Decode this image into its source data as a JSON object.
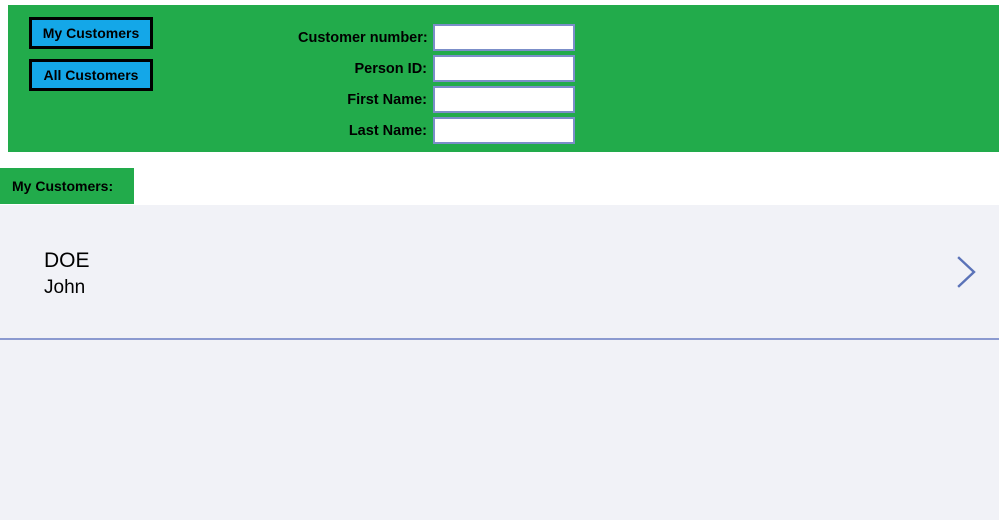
{
  "colors": {
    "panel_green": "#22ab4b",
    "button_blue": "#14a7e8",
    "field_border": "#7b8ec9",
    "list_background": "#f1f2f7",
    "divider": "#8b9ad0",
    "chevron": "#5b73b8"
  },
  "search_panel": {
    "buttons": [
      {
        "label": "My Customers",
        "name": "my-customers-button"
      },
      {
        "label": "All Customers",
        "name": "all-customers-button"
      }
    ],
    "fields": [
      {
        "label": "Customer number:",
        "value": "",
        "placeholder": "",
        "name": "customer-number"
      },
      {
        "label": "Person ID:",
        "value": "",
        "placeholder": "",
        "name": "person-id"
      },
      {
        "label": "First Name:",
        "value": "",
        "placeholder": "",
        "name": "first-name"
      },
      {
        "label": "Last Name:",
        "value": "",
        "placeholder": "",
        "name": "last-name"
      }
    ]
  },
  "results": {
    "tab_label": "My Customers:",
    "items": [
      {
        "last_name": "DOE",
        "first_name": "John",
        "chevron_icon": "chevron-right-icon"
      }
    ]
  }
}
